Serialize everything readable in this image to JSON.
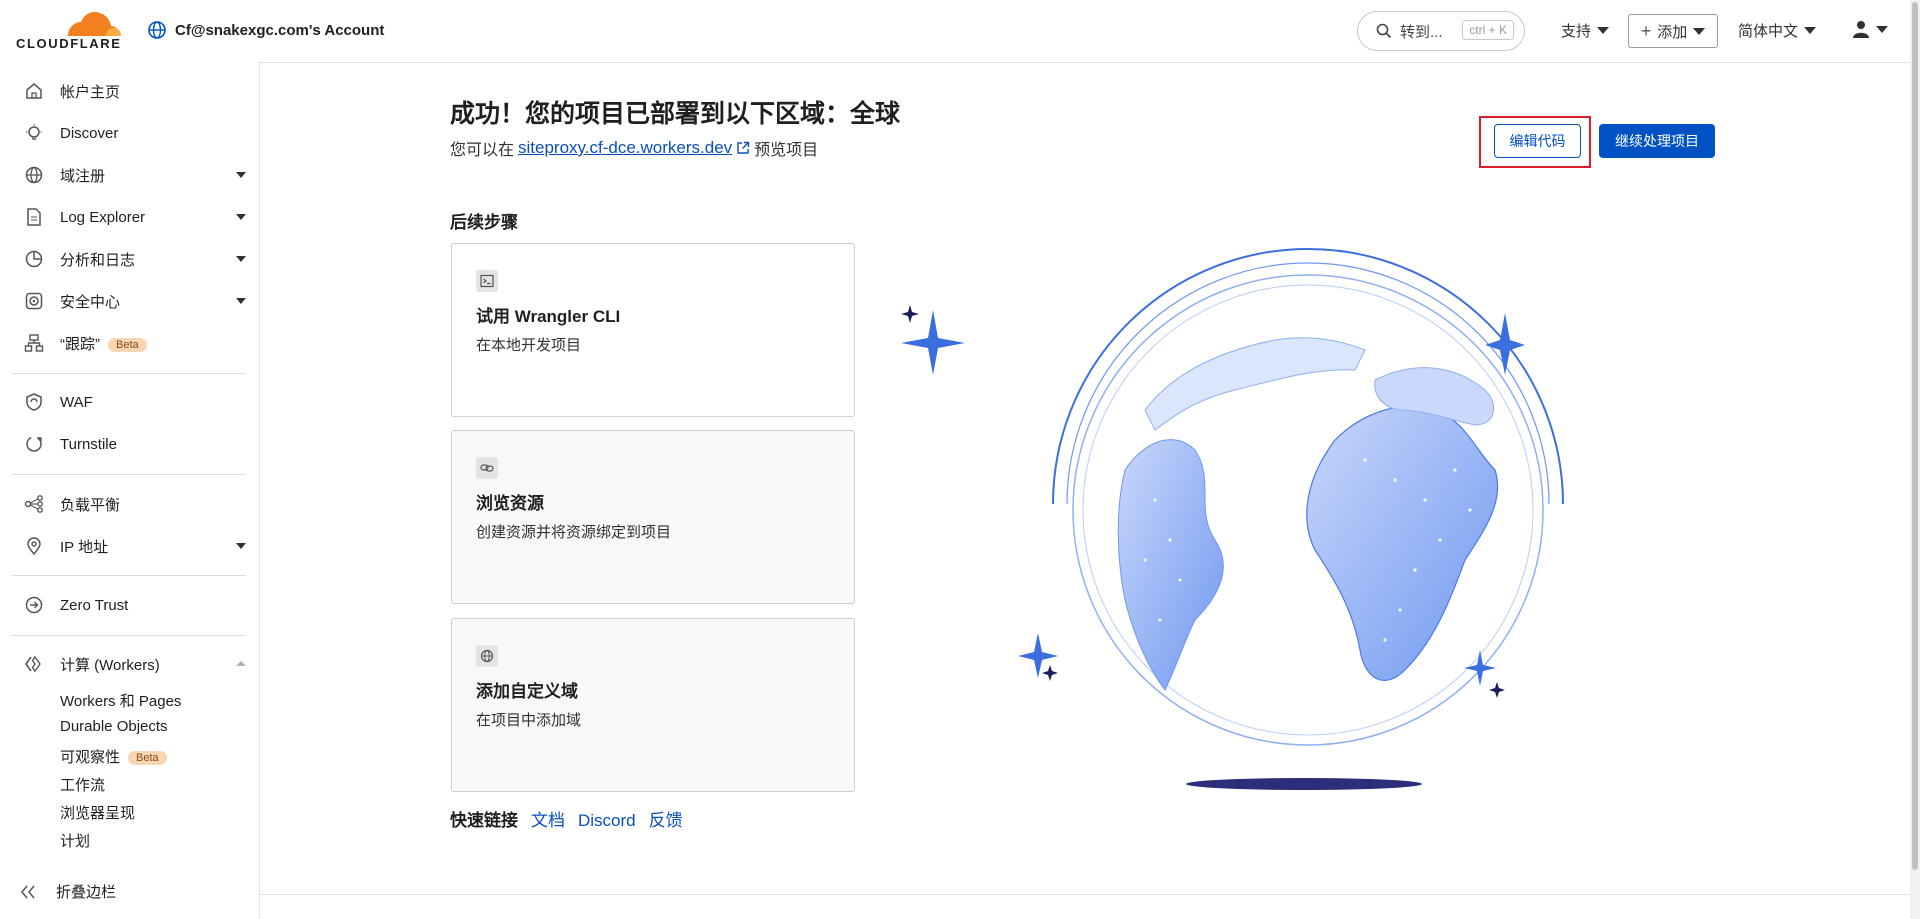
{
  "header": {
    "brand": "CLOUDFLARE",
    "account_name": "Cf@snakexgc.com's Account",
    "search_label": "转到...",
    "search_shortcut": "ctrl + K",
    "support_label": "支持",
    "add_label": "添加",
    "language_label": "简体中文"
  },
  "sidebar": {
    "items": [
      {
        "label": "帐户主页",
        "icon": "home-icon"
      },
      {
        "label": "Discover",
        "icon": "bulb-icon"
      },
      {
        "label": "域注册",
        "icon": "globe-icon"
      },
      {
        "label": "Log Explorer",
        "icon": "document-icon"
      },
      {
        "label": "分析和日志",
        "icon": "pie-chart-icon"
      },
      {
        "label": "安全中心",
        "icon": "shield-target-icon"
      },
      {
        "label": "“跟踪”",
        "icon": "sitemap-icon",
        "badge": "Beta"
      },
      {
        "label": "WAF",
        "icon": "waf-icon"
      },
      {
        "label": "Turnstile",
        "icon": "turnstile-icon"
      },
      {
        "label": "负载平衡",
        "icon": "load-balancer-icon"
      },
      {
        "label": "IP 地址",
        "icon": "location-pin-icon"
      },
      {
        "label": "Zero Trust",
        "icon": "zero-trust-icon"
      },
      {
        "label": "计算 (Workers)",
        "icon": "workers-icon"
      }
    ],
    "workers_sub": [
      {
        "label": "Workers 和 Pages"
      },
      {
        "label": "Durable Objects"
      },
      {
        "label": "可观察性",
        "badge": "Beta"
      },
      {
        "label": "工作流"
      },
      {
        "label": "浏览器呈现"
      },
      {
        "label": "计划"
      }
    ],
    "collapse_label": "折叠边栏"
  },
  "main": {
    "title": "成功！您的项目已部署到以下区域：全球",
    "preview_prefix": "您可以在",
    "preview_link": "siteproxy.cf-dce.workers.dev",
    "preview_suffix": "预览项目",
    "edit_code_label": "编辑代码",
    "continue_label": "继续处理项目",
    "next_steps_heading": "后续步骤",
    "cards": [
      {
        "title": "试用 Wrangler CLI",
        "desc": "在本地开发项目",
        "icon": "terminal-icon"
      },
      {
        "title": "浏览资源",
        "desc": "创建资源并将资源绑定到项目",
        "icon": "link-icon"
      },
      {
        "title": "添加自定义域",
        "desc": "在项目中添加域",
        "icon": "globe-icon"
      }
    ],
    "quick_links_label": "快速链接",
    "quick_links": [
      "文档",
      "Discord",
      "反馈"
    ]
  },
  "colors": {
    "accent": "#0051c3",
    "brand_orange": "#f38020",
    "highlight_red": "#d8202a",
    "globe_blue": "#3b6fe0"
  }
}
